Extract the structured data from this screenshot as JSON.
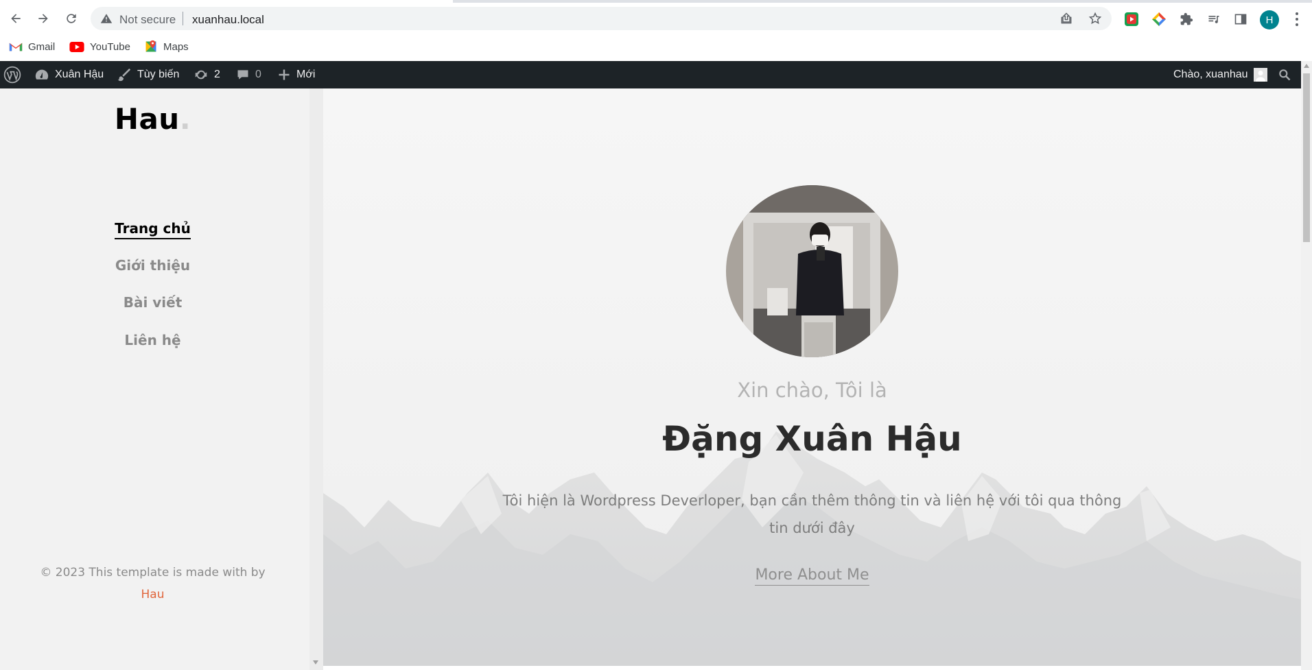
{
  "browser": {
    "security_label": "Not secure",
    "url": "xuanhau.local",
    "profile_initial": "H",
    "bookmarks": [
      {
        "label": "Gmail",
        "icon": "gmail-icon"
      },
      {
        "label": "YouTube",
        "icon": "youtube-icon"
      },
      {
        "label": "Maps",
        "icon": "maps-icon"
      }
    ],
    "colors": {
      "profile": "#00838f"
    }
  },
  "adminbar": {
    "site_name": "Xuân Hậu",
    "customize": "Tùy biến",
    "updates_count": "2",
    "comments_count": "0",
    "new_label": "Mới",
    "greeting": "Chào, xuanhau"
  },
  "sidebar": {
    "logo_text": "Hau",
    "logo_dot": ".",
    "nav": [
      {
        "label": "Trang chủ",
        "active": true
      },
      {
        "label": "Giới thiệu",
        "active": false
      },
      {
        "label": "Bài viết",
        "active": false
      },
      {
        "label": "Liên hệ",
        "active": false
      }
    ],
    "copyright_text": "© 2023 This template is made with by",
    "copyright_link": "Hau",
    "colors": {
      "link": "#e0653b",
      "admin_bar": "#1d2327"
    }
  },
  "hero": {
    "greeting": "Xin chào, Tôi là",
    "name": "Đặng Xuân Hậu",
    "intro": "Tôi hiện là Wordpress Deverloper, bạn cần thêm thông tin và liên hệ với tôi qua thông tin dưới đây",
    "cta": "More About Me"
  }
}
